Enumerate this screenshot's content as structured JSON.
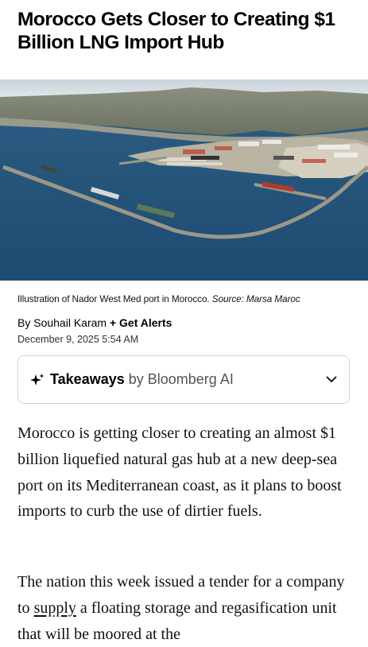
{
  "article": {
    "headline": "Morocco Gets Closer to Creating $1 Billion LNG Import Hub",
    "image_caption": "Illustration of Nador West Med port in Morocco.",
    "image_source": "Source: Marsa Maroc",
    "byline_prefix": "By Souhail Karam",
    "get_alerts_label": "+ Get Alerts",
    "date": "December 9, 2025 5:54 AM"
  },
  "takeaways": {
    "title": "Takeaways",
    "by": "by Bloomberg AI",
    "icon": "sparkle-icon",
    "toggle_icon": "chevron-down-icon"
  },
  "body": {
    "p1": "Morocco is getting closer to creating an almost $1 billion liquefied natural gas hub at a new deep-sea port on its Mediterranean coast, as it plans to boost imports to curb the use of dirtier fuels.",
    "p2_before": "The nation this week issued a tender for a company to ",
    "p2_link": "supply",
    "p2_after": " a floating storage and regasification unit that will be moored at the"
  }
}
